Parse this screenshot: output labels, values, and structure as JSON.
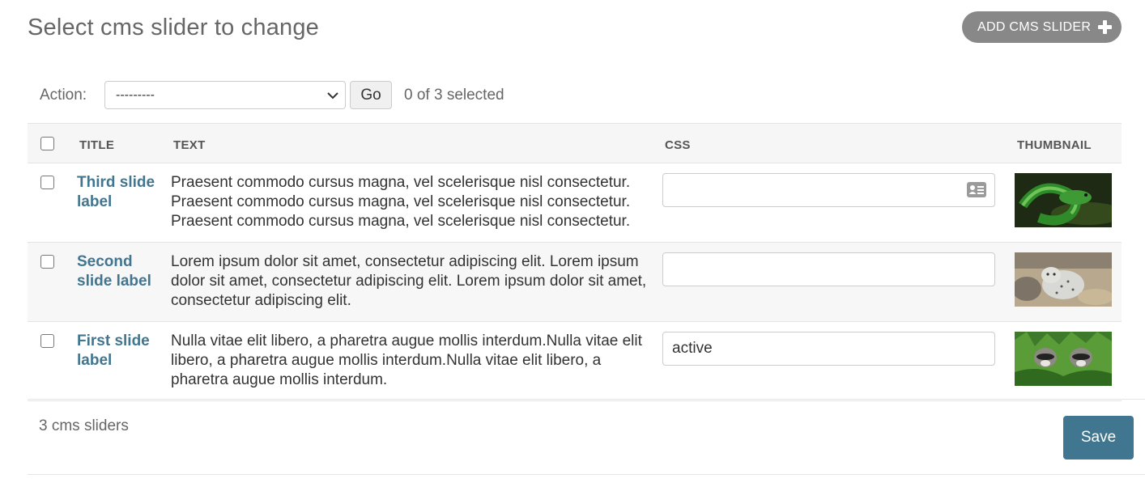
{
  "header": {
    "title": "Select cms slider to change",
    "add_button_label": "ADD CMS SLIDER"
  },
  "actions": {
    "label": "Action:",
    "selected_option": "---------",
    "go_label": "Go",
    "selection_status": "0 of 3 selected"
  },
  "table": {
    "columns": [
      "TITLE",
      "TEXT",
      "CSS",
      "THUMBNAIL"
    ],
    "rows": [
      {
        "title": "Third slide label",
        "text": "Praesent commodo cursus magna, vel scelerisque nisl consectetur. Praesent commodo cursus magna, vel scelerisque nisl consectetur. Praesent commodo cursus magna, vel scelerisque nisl consectetur.",
        "css": "",
        "thumbnail": "green snake"
      },
      {
        "title": "Second slide label",
        "text": "Lorem ipsum dolor sit amet, consectetur adipiscing elit. Lorem ipsum dolor sit amet, consectetur adipiscing elit. Lorem ipsum dolor sit amet, consectetur adipiscing elit.",
        "css": "",
        "thumbnail": "snow leopard"
      },
      {
        "title": "First slide label",
        "text": "Nulla vitae elit libero, a pharetra augue mollis interdum.Nulla vitae elit libero, a pharetra augue mollis interdum.Nulla vitae elit libero, a pharetra augue mollis interdum.",
        "css": "active",
        "thumbnail": "raccoons"
      }
    ]
  },
  "footer": {
    "result_count": "3 cms sliders",
    "save_label": "Save"
  },
  "colors": {
    "accent": "#417690",
    "add_button": "#888888",
    "row_alt": "#f7f7f7"
  },
  "icons": {
    "add": "plus-icon",
    "select": "chevron-down-icon",
    "autofill": "card-icon"
  }
}
